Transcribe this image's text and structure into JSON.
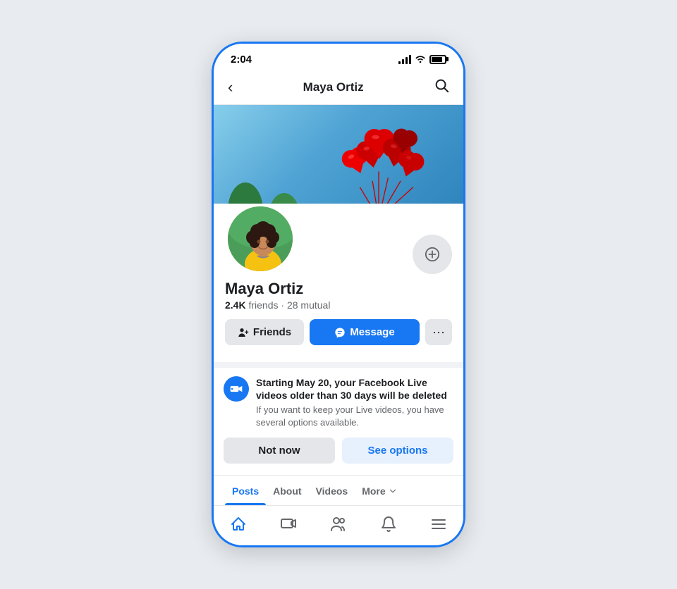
{
  "status_bar": {
    "time": "2:04"
  },
  "nav": {
    "title": "Maya Ortiz",
    "back_label": "‹",
    "search_label": "🔍"
  },
  "profile": {
    "name": "Maya Ortiz",
    "friends_count": "2.4K",
    "mutual_count": "28",
    "friends_label": "friends",
    "mutual_label": "mutual",
    "btn_friends": "Friends",
    "btn_message": "Message",
    "btn_more": "···"
  },
  "notification": {
    "title": "Starting May 20, your Facebook Live videos older than 30 days will be deleted",
    "body": "If you want to keep your Live videos, you have several options available.",
    "btn_not_now": "Not now",
    "btn_see_options": "See options"
  },
  "tabs": [
    {
      "label": "Posts",
      "active": true
    },
    {
      "label": "About",
      "active": false
    },
    {
      "label": "Videos",
      "active": false
    },
    {
      "label": "More",
      "active": false
    }
  ],
  "bottom_nav": [
    {
      "name": "home",
      "active": true
    },
    {
      "name": "watch",
      "active": false
    },
    {
      "name": "people",
      "active": false
    },
    {
      "name": "notifications",
      "active": false
    },
    {
      "name": "menu",
      "active": false
    }
  ]
}
